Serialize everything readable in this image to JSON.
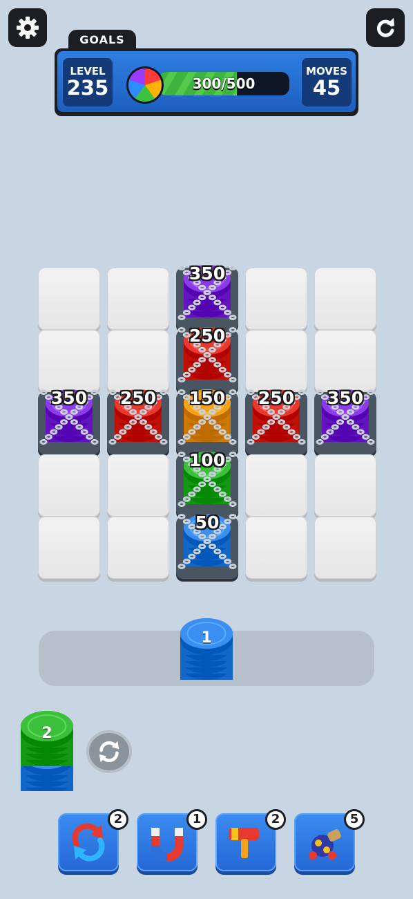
{
  "hud": {
    "goals_label": "GOALS",
    "level_label": "LEVEL",
    "level_value": "235",
    "moves_label": "MOVES",
    "moves_value": "45",
    "progress_text": "300/500",
    "progress_fraction": 0.6
  },
  "icons": {
    "settings": "gear-icon",
    "restart": "restart-icon",
    "goal": "rainbow-ball-icon",
    "swap": "swap-icon",
    "boosters": [
      "shuffle-icon",
      "magnet-icon",
      "hammer-icon",
      "cannon-icon"
    ]
  },
  "colors": {
    "purple": "#8b3be8",
    "red": "#e8392f",
    "orange": "#f5a21a",
    "green": "#3cc03c",
    "blue": "#3b8ff0"
  },
  "board": {
    "rows": 5,
    "cols": 5,
    "chips": [
      {
        "row": 0,
        "col": 2,
        "value": "350",
        "color": "purple",
        "chained": true
      },
      {
        "row": 1,
        "col": 2,
        "value": "250",
        "color": "red",
        "chained": true
      },
      {
        "row": 2,
        "col": 0,
        "value": "350",
        "color": "purple",
        "chained": true
      },
      {
        "row": 2,
        "col": 1,
        "value": "250",
        "color": "red",
        "chained": true
      },
      {
        "row": 2,
        "col": 2,
        "value": "150",
        "color": "orange",
        "chained": true
      },
      {
        "row": 2,
        "col": 3,
        "value": "250",
        "color": "red",
        "chained": true
      },
      {
        "row": 2,
        "col": 4,
        "value": "350",
        "color": "purple",
        "chained": true
      },
      {
        "row": 3,
        "col": 2,
        "value": "100",
        "color": "green",
        "chained": true
      },
      {
        "row": 4,
        "col": 2,
        "value": "50",
        "color": "blue",
        "chained": true
      }
    ]
  },
  "tray": {
    "value": "1",
    "color": "blue"
  },
  "next_stack": {
    "value": "2",
    "top_color": "green",
    "bottom_color": "blue"
  },
  "boosters": [
    {
      "name": "shuffle",
      "count": "2"
    },
    {
      "name": "magnet",
      "count": "1"
    },
    {
      "name": "hammer",
      "count": "2"
    },
    {
      "name": "cannon",
      "count": "5"
    }
  ]
}
